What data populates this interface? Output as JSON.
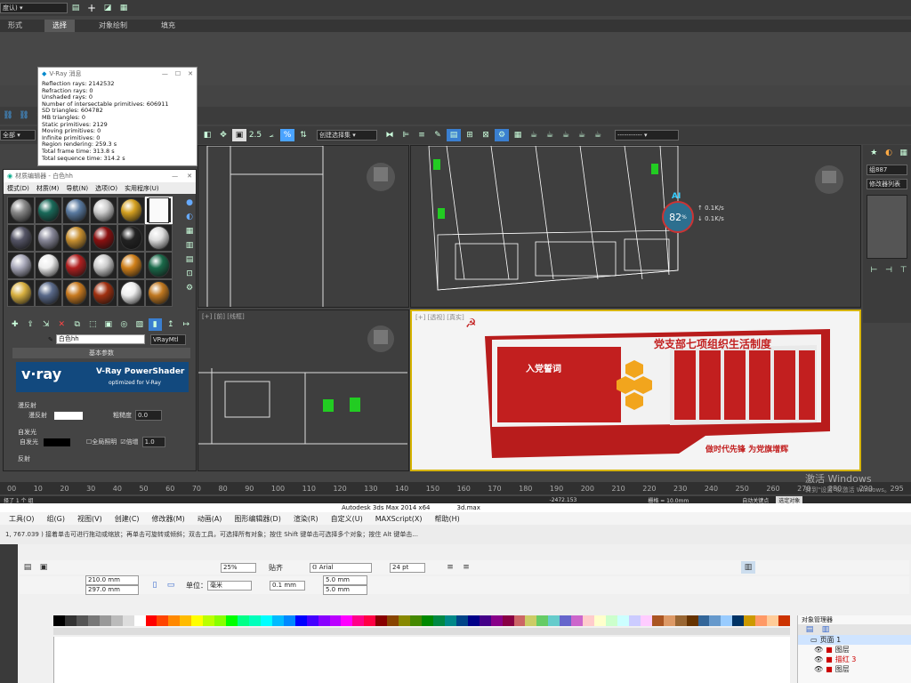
{
  "max": {
    "toolbar1": {
      "combo_value": "度认)"
    },
    "ribbon_tabs": [
      "形式",
      "选择",
      "对象绘制",
      "填充"
    ],
    "ribbon_selected": 1,
    "selection_filter": "全部",
    "named_selection": "创建选择集",
    "right_panel": {
      "name": "组887",
      "modifier_list": "修改器列表"
    },
    "vp_labels": [
      "[+] [前] [线框]",
      "[+] [透视] [真实]"
    ],
    "perf": {
      "percent": "82",
      "unit": "%",
      "ai": "AI",
      "up": "0.1K/s",
      "down": "0.1K/s"
    },
    "timeline_ticks": [
      "00",
      "10",
      "20",
      "30",
      "40",
      "50",
      "60",
      "70",
      "80",
      "90",
      "100",
      "110",
      "120",
      "130",
      "140",
      "150",
      "160",
      "170",
      "180",
      "190",
      "200",
      "210",
      "220",
      "230",
      "240",
      "250",
      "260",
      "270",
      "280",
      "290",
      "295"
    ],
    "status": {
      "left": "择了 1 个 组",
      "title": "Autodesk 3ds Max  2014 x64",
      "file": "3d.max",
      "coords": "-2472.153",
      "grid": "栅格 = 10.0mm",
      "auto_key": "自动关键点",
      "sel_obj": "选定对象"
    },
    "watermark": {
      "line1": "激活 Windows",
      "line2": "转到\"设置\"以激活 Windows。"
    }
  },
  "vray_msg": {
    "title": "V-Ray 消息",
    "lines": [
      "Reflection rays: 2142532",
      "Refraction rays: 0",
      "Unshaded rays: 0",
      "Number of intersectable primitives: 606911",
      "SD triangles: 604782",
      "MB triangles: 0",
      "Static primitives: 2129",
      "Moving primitives: 0",
      "Infinite primitives: 0",
      "Region rendering: 259.3 s",
      "Total frame time: 313.8 s",
      "Total sequence time: 314.2 s"
    ]
  },
  "mat_editor": {
    "title": "材质编辑器 - 白色hh",
    "menu": [
      "模式(D)",
      "材质(M)",
      "导航(N)",
      "选项(O)",
      "实用程序(U)"
    ],
    "mat_name": "白色hh",
    "mat_type": "VRayMtl",
    "rollout": "基本参数",
    "vray_logo": "v·ray",
    "powershader": "V-Ray PowerShader",
    "optimized": "optimized for V-Ray",
    "diffuse_group": "漫反射",
    "diffuse": "漫反射",
    "roughness": "粗糙度",
    "roughness_val": "0.0",
    "self_illum": "自发光",
    "self_illum_label": "自发光",
    "gi": "全局照明",
    "mult": "倍增",
    "mult_val": "1.0",
    "reflect": "反射",
    "swatch_colors": [
      "#888",
      "#1a6a5a",
      "#5a7aa0",
      "#ccc",
      "#d4a020",
      "#f8f8f8",
      "#556",
      "#889",
      "#c89030",
      "#8a1010",
      "#222",
      "#ddd",
      "#aab",
      "#eee",
      "#b02020",
      "#ccc",
      "#d0801a",
      "#1a6a4a",
      "#d8b040",
      "#5a6a8a",
      "#c87a20",
      "#a03010",
      "#eee",
      "#c07820"
    ]
  },
  "board": {
    "title": "党支部七项组织生活制度",
    "left": "入党誓词",
    "bottom": "做时代先锋 为党旗增辉"
  },
  "cd": {
    "menu": [
      "工具(O)",
      "组(G)",
      "视图(V)",
      "创建(C)",
      "修改器(M)",
      "动画(A)",
      "图形编辑器(D)",
      "渲染(R)",
      "自定义(U)",
      "MAXScript(X)",
      "帮助(H)"
    ],
    "hint": "1, 767.039 ) 接着单击可进行拖动或缩放；再单击可旋转或倾斜；双击工具，可选择所有对象；按住 Shift 键单击可选择多个对象；按住 Alt 键单击...",
    "zoom": "25%",
    "snap": "贴齐",
    "font": "Arial",
    "size": "24 pt",
    "w": "210.0 mm",
    "h": "297.0 mm",
    "unit": "单位：",
    "unit_val": "毫米",
    "nudge": "0.1 mm",
    "dup1": "5.0 mm",
    "dup2": "5.0 mm",
    "obj_mgr": "对象管理器",
    "page": "页面 1",
    "layers": [
      "图层",
      "描红 3",
      "图层"
    ]
  }
}
